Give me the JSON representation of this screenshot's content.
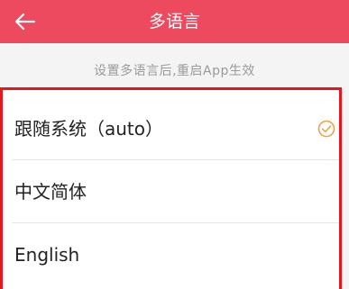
{
  "header": {
    "title": "多语言",
    "back_icon": "back-arrow-icon",
    "background": "#ee4a5f"
  },
  "hint": "设置多语言后,重启App生效",
  "languages": [
    {
      "label": "跟随系统（auto）",
      "selected": true
    },
    {
      "label": "中文简体",
      "selected": false
    },
    {
      "label": "English",
      "selected": false
    }
  ],
  "colors": {
    "accent": "#ee4a5f",
    "check": "#f0a04b",
    "highlight_border": "#e8151f"
  }
}
